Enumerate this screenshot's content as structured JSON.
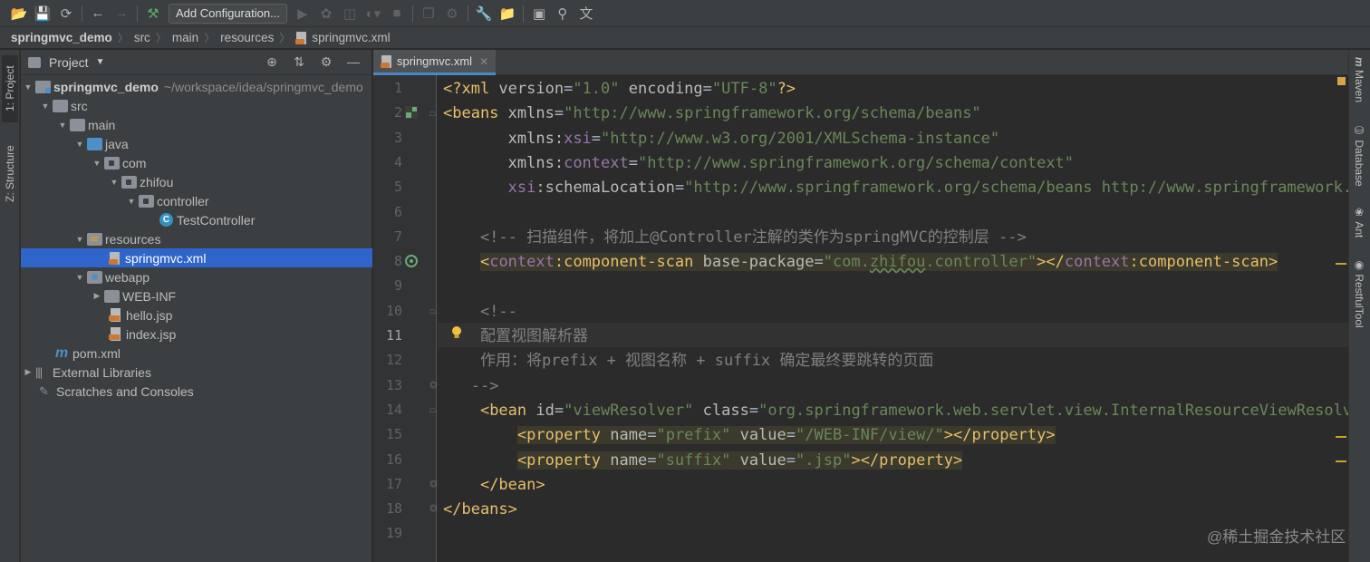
{
  "toolbar": {
    "run_config_label": "Add Configuration..."
  },
  "breadcrumb": [
    "springmvc_demo",
    "src",
    "main",
    "resources",
    "springmvc.xml"
  ],
  "left_stripe": {
    "tabs": [
      {
        "label": "1: Project",
        "active": true
      },
      {
        "label": "Z: Structure",
        "active": false
      }
    ]
  },
  "right_stripe": {
    "tabs": [
      "Maven",
      "Database",
      "Ant",
      "RestfulTool"
    ]
  },
  "project_panel": {
    "title": "Project",
    "tree": [
      {
        "label": "springmvc_demo",
        "hint": "~/workspace/idea/springmvc_demo",
        "type": "project",
        "bold": true
      },
      {
        "label": "src",
        "type": "folder"
      },
      {
        "label": "main",
        "type": "folder"
      },
      {
        "label": "java",
        "type": "source-folder"
      },
      {
        "label": "com",
        "type": "package"
      },
      {
        "label": "zhifou",
        "type": "package"
      },
      {
        "label": "controller",
        "type": "package"
      },
      {
        "label": "TestController",
        "type": "class"
      },
      {
        "label": "resources",
        "type": "resources-folder"
      },
      {
        "label": "springmvc.xml",
        "type": "xml",
        "selected": true
      },
      {
        "label": "webapp",
        "type": "web-folder"
      },
      {
        "label": "WEB-INF",
        "type": "folder"
      },
      {
        "label": "hello.jsp",
        "type": "jsp"
      },
      {
        "label": "index.jsp",
        "type": "jsp"
      },
      {
        "label": "pom.xml",
        "type": "maven"
      },
      {
        "label": "External Libraries",
        "type": "libraries"
      },
      {
        "label": "Scratches and Consoles",
        "type": "scratches"
      }
    ]
  },
  "editor": {
    "tab_label": "springmvc.xml",
    "current_line": 11,
    "line_numbers": [
      "1",
      "2",
      "3",
      "4",
      "5",
      "6",
      "7",
      "8",
      "9",
      "10",
      "11",
      "12",
      "13",
      "14",
      "15",
      "16",
      "17",
      "18",
      "19"
    ],
    "lines": [
      [
        [
          "pi",
          "<?xml "
        ],
        [
          "attr",
          "version"
        ],
        [
          "plain",
          "="
        ],
        [
          "val",
          "\"1.0\""
        ],
        [
          "plain",
          " "
        ],
        [
          "attr",
          "encoding"
        ],
        [
          "plain",
          "="
        ],
        [
          "val",
          "\"UTF-8\""
        ],
        [
          "pi",
          "?>"
        ]
      ],
      [
        [
          "tag",
          "<beans "
        ],
        [
          "attr",
          "xmlns"
        ],
        [
          "plain",
          "="
        ],
        [
          "val",
          "\"http://www.springframework.org/schema/beans\""
        ]
      ],
      [
        [
          "plain",
          "       "
        ],
        [
          "attr",
          "xmlns:"
        ],
        [
          "ns",
          "xsi"
        ],
        [
          "plain",
          "="
        ],
        [
          "val",
          "\"http://www.w3.org/2001/XMLSchema-instance\""
        ]
      ],
      [
        [
          "plain",
          "       "
        ],
        [
          "attr",
          "xmlns:"
        ],
        [
          "ns",
          "context"
        ],
        [
          "plain",
          "="
        ],
        [
          "val",
          "\"http://www.springframework.org/schema/context\""
        ]
      ],
      [
        [
          "plain",
          "       "
        ],
        [
          "ns",
          "xsi"
        ],
        [
          "attr",
          ":schemaLocation"
        ],
        [
          "plain",
          "="
        ],
        [
          "val",
          "\"http://www.springframework.org/schema/beans http://www.springframework.org/schema/beans/spring-beans.xsd\""
        ]
      ],
      [],
      [
        [
          "cmt",
          "    <!-- 扫描组件，将加上@Controller注解的类作为springMVC的控制层 -->"
        ]
      ],
      [
        [
          "plain",
          "    "
        ],
        [
          "tag",
          "<"
        ],
        [
          "ns",
          "context"
        ],
        [
          "tag",
          ":component-scan "
        ],
        [
          "attr",
          "base-package"
        ],
        [
          "plain",
          "="
        ],
        [
          "val",
          "\"com."
        ],
        [
          "valu",
          "zhifou"
        ],
        [
          "val",
          ".controller\""
        ],
        [
          "tag",
          "></"
        ],
        [
          "ns",
          "context"
        ],
        [
          "tag",
          ":component-scan>"
        ]
      ],
      [],
      [
        [
          "cmt",
          "    <!--"
        ]
      ],
      [
        [
          "cmt",
          "    配置视图解析器"
        ]
      ],
      [
        [
          "cmt",
          "    作用：将prefix + 视图名称 + suffix 确定最终要跳转的页面"
        ]
      ],
      [
        [
          "cmt",
          "   -->"
        ]
      ],
      [
        [
          "plain",
          "    "
        ],
        [
          "tag",
          "<bean "
        ],
        [
          "attr",
          "id"
        ],
        [
          "plain",
          "="
        ],
        [
          "val",
          "\"viewResolver\""
        ],
        [
          "plain",
          " "
        ],
        [
          "attr",
          "class"
        ],
        [
          "plain",
          "="
        ],
        [
          "val",
          "\"org.springframework.web.servlet.view.InternalResourceViewResolver\""
        ],
        [
          "tag",
          ">"
        ]
      ],
      [
        [
          "plain",
          "        "
        ],
        [
          "tag",
          "<property "
        ],
        [
          "attr",
          "name"
        ],
        [
          "plain",
          "="
        ],
        [
          "val",
          "\"prefix\""
        ],
        [
          "plain",
          " "
        ],
        [
          "attr",
          "value"
        ],
        [
          "plain",
          "="
        ],
        [
          "val",
          "\"/WEB-INF/view/\""
        ],
        [
          "tag",
          "></property>"
        ]
      ],
      [
        [
          "plain",
          "        "
        ],
        [
          "tag",
          "<property "
        ],
        [
          "attr",
          "name"
        ],
        [
          "plain",
          "="
        ],
        [
          "val",
          "\"suffix\""
        ],
        [
          "plain",
          " "
        ],
        [
          "attr",
          "value"
        ],
        [
          "plain",
          "="
        ],
        [
          "val",
          "\".jsp\""
        ],
        [
          "tag",
          "></property>"
        ]
      ],
      [
        [
          "plain",
          "    "
        ],
        [
          "tag",
          "</bean>"
        ]
      ],
      [
        [
          "tag",
          "</beans>"
        ]
      ],
      []
    ]
  },
  "watermark": "@稀土掘金技术社区",
  "colors": {
    "tag": "#e8bf6a",
    "value": "#6a8759",
    "namespace": "#9876aa",
    "comment": "#808080",
    "selection": "#2f65ca",
    "tab_underline": "#4a88c7"
  }
}
